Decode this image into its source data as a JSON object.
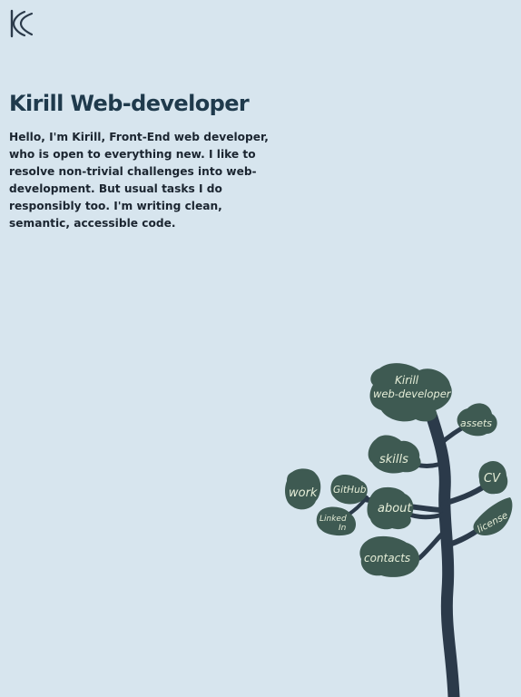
{
  "header": {
    "logo_text": "KS"
  },
  "main": {
    "title": "Kirill Web-developer",
    "intro": "Hello, I'm Kirill, Front-End web developer, who is open to everything new. I like to resolve non-trivial challenges into web-development. But usual tasks I do responsibly too. I'm writing clean, semantic, accessible code."
  },
  "tree": {
    "top_line1": "Kirill",
    "top_line2": "web-developer",
    "assets": "assets",
    "skills": "skills",
    "cv": "CV",
    "work": "work",
    "github": "GitHub",
    "about": "about",
    "license": "license",
    "linkedin_line1": "Linked",
    "linkedin_line2": "In",
    "contacts": "contacts"
  },
  "colors": {
    "background": "#d7e5ee",
    "title": "#1f3a4c",
    "trunk": "#2b3a4a",
    "leaf": "#3e5a52",
    "leaf_text": "#e6eed8"
  }
}
